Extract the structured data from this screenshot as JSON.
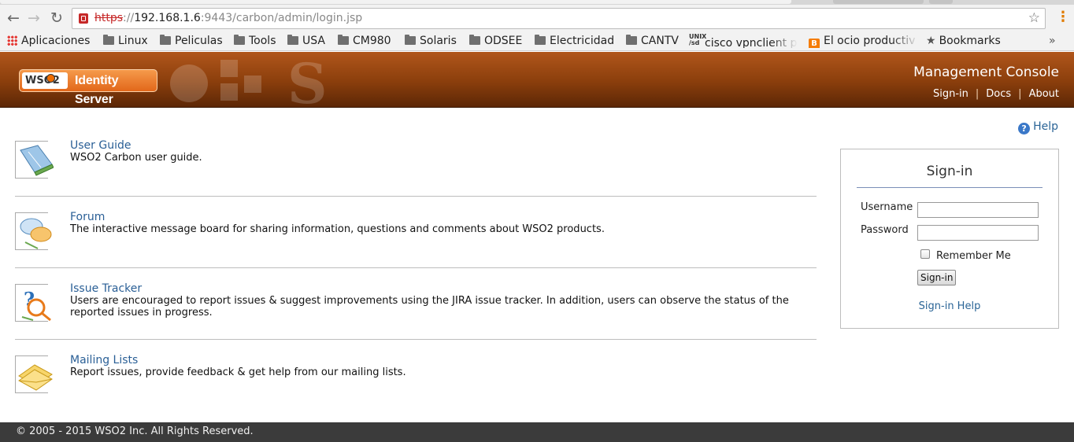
{
  "browser": {
    "url": {
      "scheme": "https",
      "separator": "://",
      "host": "192.168.1.6",
      "path": ":9443/carbon/admin/login.jsp"
    },
    "nav_icons": [
      "back-arrow-icon",
      "forward-arrow-icon",
      "reload-icon"
    ],
    "bookmarks": [
      {
        "label": "Aplicaciones",
        "icon": "apps-icon"
      },
      {
        "label": "Linux",
        "icon": "folder-icon"
      },
      {
        "label": "Peliculas",
        "icon": "folder-icon"
      },
      {
        "label": "Tools",
        "icon": "folder-icon"
      },
      {
        "label": "USA",
        "icon": "folder-icon"
      },
      {
        "label": "CM980",
        "icon": "folder-icon"
      },
      {
        "label": "Solaris",
        "icon": "folder-icon"
      },
      {
        "label": "ODSEE",
        "icon": "folder-icon"
      },
      {
        "label": "Electricidad",
        "icon": "folder-icon"
      },
      {
        "label": "CANTV",
        "icon": "folder-icon"
      },
      {
        "label": "cisco vpnclient p",
        "icon": "unix-icon"
      },
      {
        "label": "El ocio productiv",
        "icon": "blogger-icon"
      },
      {
        "label": "Bookmarks",
        "icon": "star-icon"
      }
    ],
    "overflow_label": "»"
  },
  "header": {
    "logo_brand": "WSO2",
    "logo_product": "Identity Server",
    "title": "Management Console",
    "links": [
      "Sign-in",
      "Docs",
      "About"
    ],
    "background_color": "#8a3e0c"
  },
  "help": {
    "label": "Help"
  },
  "resources": [
    {
      "title": "User Guide",
      "description": "WSO2 Carbon user guide.",
      "icon": "user-guide-book-icon"
    },
    {
      "title": "Forum",
      "description": "The interactive message board for sharing information, questions and comments about WSO2 products.",
      "icon": "forum-speech-bubbles-icon"
    },
    {
      "title": "Issue Tracker",
      "description": "Users are encouraged to report issues & suggest improvements using the JIRA issue tracker. In addition, users can observe the status of the reported issues in progress.",
      "icon": "issue-tracker-question-icon"
    },
    {
      "title": "Mailing Lists",
      "description": "Report issues, provide feedback & get help from our mailing lists.",
      "icon": "mailing-list-envelope-icon"
    }
  ],
  "signin": {
    "title": "Sign-in",
    "username_label": "Username",
    "username_value": "",
    "password_label": "Password",
    "password_value": "",
    "remember_label": "Remember Me",
    "remember_checked": false,
    "button_label": "Sign-in",
    "help_link": "Sign-in Help"
  },
  "footer": {
    "text": "© 2005 - 2015 WSO2 Inc. All Rights Reserved."
  }
}
